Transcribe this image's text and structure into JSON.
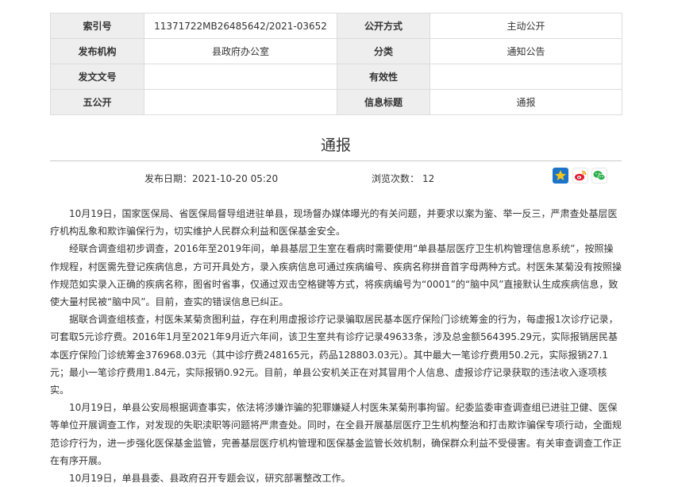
{
  "meta": {
    "rows": [
      {
        "l1": "索引号",
        "v1": "11371722MB26485642/2021-03652",
        "l2": "公开方式",
        "v2": "主动公开"
      },
      {
        "l1": "发布机构",
        "v1": "县政府办公室",
        "l2": "分类",
        "v2": "通知公告"
      },
      {
        "l1": "发文文号",
        "v1": "",
        "l2": "有效性",
        "v2": ""
      },
      {
        "l1": "五公开",
        "v1": "",
        "l2": "信息标题",
        "v2": "通报"
      }
    ]
  },
  "article": {
    "title": "通报",
    "publish_date_label": "发布日期：",
    "publish_date": "2021-10-20 05:20",
    "views_label": "浏览次数：",
    "views": "12",
    "paragraphs": [
      "10月19日，国家医保局、省医保局督导组进驻单县，现场督办媒体曝光的有关问题，并要求以案为鉴、举一反三，严肃查处基层医疗机构乱象和欺诈骗保行为，切实维护人民群众利益和医保基金安全。",
      "经联合调查组初步调查，2016年至2019年间，单县基层卫生室在看病时需要使用“单县基层医疗卫生机构管理信息系统”，按照操作规程，村医需先登记疾病信息，方可开具处方，录入疾病信息可通过疾病编号、疾病名称拼音首字母两种方式。村医朱某菊没有按照操作规范如实录入正确的疾病名称，图省时省事，仅通过双击空格键等方式，将疾病编号为“0001”的“脑中风”直接默认生成疾病信息，致使大量村民被“脑中风”。目前，查实的错误信息已纠正。",
      "据联合调查组核查，村医朱某菊贪图利益，存在利用虚报诊疗记录骗取居民基本医疗保险门诊统筹金的行为，每虚报1次诊疗记录，可套取5元诊疗费。2016年1月至2021年9月近六年间，该卫生室共有诊疗记录49633条，涉及总金额564395.29元，实际报销居民基本医疗保险门诊统筹金376968.03元（其中诊疗费248165元，药品128803.03元）。其中最大一笔诊疗费用50.2元，实际报销27.1元；最小一笔诊疗费用1.84元，实际报销0.92元。目前，单县公安机关正在对其冒用个人信息、虚报诊疗记录获取的违法收入逐项核实。",
      "10月19日，单县公安局根据调查事实，依法将涉嫌诈骗的犯罪嫌疑人村医朱某菊刑事拘留。纪委监委审查调查组已进驻卫健、医保等单位开展调查工作，对发现的失职渎职等问题将严肃查处。同时，在全县开展基层医疗卫生机构整治和打击欺诈骗保专项行动，全面规范诊疗行为，进一步强化医保基金监管，完善基层医疗机构管理和医保基金监管长效机制，确保群众利益不受侵害。有关审查调查工作正在有序开展。",
      "10月19日，单县县委、县政府召开专题会议，研究部署整改工作。"
    ]
  },
  "share": {
    "icons": [
      "favorite-icon",
      "weibo-icon",
      "wechat-icon"
    ],
    "colors": {
      "favorite": "#1a74c9",
      "star": "#f5c518",
      "weibo": "#e6162d",
      "wechat": "#2aae4a"
    }
  }
}
